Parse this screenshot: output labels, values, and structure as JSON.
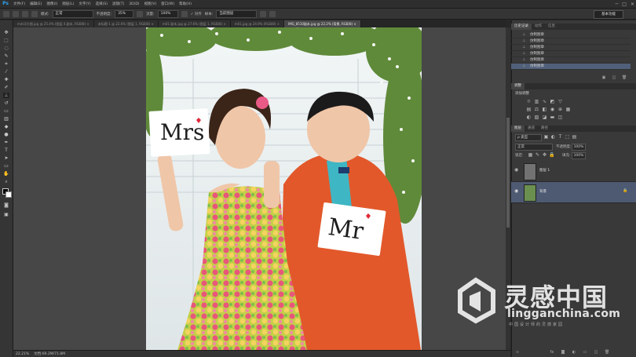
{
  "app": {
    "logo": "Ps"
  },
  "menubar": {
    "items": [
      "文件(F)",
      "编辑(E)",
      "图像(I)",
      "图层(L)",
      "文字(Y)",
      "选择(S)",
      "滤镜(T)",
      "3D(D)",
      "视图(V)",
      "窗口(W)",
      "帮助(H)"
    ],
    "controls": [
      "─",
      "□",
      "✕"
    ]
  },
  "options": {
    "mode_label": "模式:",
    "mode_value": "正常",
    "opacity_label": "不透明度:",
    "opacity_value": "35%",
    "flow_label": "流量:",
    "flow_value": "100%",
    "align_label": "对齐",
    "sample_label": "样本:",
    "sample_value": "当前图层",
    "workspace": "基本功能"
  },
  "tabs": [
    {
      "label": "m水印大图.jpg @ 25.4% (图层 4 副本, RGB/8) ×",
      "active": false
    },
    {
      "label": "未标题-1 @ 22.6% (图层 1, RGB/8) ×",
      "active": false
    },
    {
      "label": "m01 副本.jpg @ 27.6% (图层 1, RGB/8) ×",
      "active": false
    },
    {
      "label": "m01.jpg @ 24.9% (RGB/8) ×",
      "active": false
    },
    {
      "label": "IMG_8510副本.jpg @ 22.2% (背景, RGB/8) ×",
      "active": true
    }
  ],
  "status": {
    "zoom": "22.21%",
    "doc": "文档:69.2M/71.8M"
  },
  "history": {
    "tabs": [
      "历史记录",
      "动作",
      "信息"
    ],
    "items": [
      "仿制图章",
      "仿制图章",
      "仿制图章",
      "仿制图章",
      "仿制图章",
      "仿制图章"
    ]
  },
  "adjust": {
    "tabs": [
      "调整"
    ],
    "title": "添加调整"
  },
  "layers": {
    "tabs": [
      "图层",
      "通道",
      "路径"
    ],
    "kind_label": "ρ 类型",
    "blend_mode": "正常",
    "opacity_label": "不透明度:",
    "opacity_value": "100%",
    "lock_label": "锁定:",
    "fill_label": "填充:",
    "fill_value": "100%",
    "rows": [
      {
        "name": "图层 1",
        "selected": false
      },
      {
        "name": "背景",
        "selected": true
      }
    ]
  },
  "photo": {
    "sign_left": "Mrs",
    "sign_right": "Mr",
    "colors": {
      "wall": "#e8eef0",
      "dress_yellow": "#c9d24a",
      "suit": "#e05a2a",
      "skin": "#f0c6a8"
    }
  },
  "watermark": {
    "chinese": "灵感中国",
    "domain": "lingganchina.com",
    "sub": "中国设计师的灵感家园"
  }
}
